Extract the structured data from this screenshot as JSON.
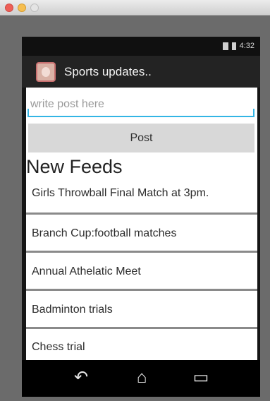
{
  "status_bar": {
    "time": "4:32"
  },
  "action_bar": {
    "title": "Sports updates.."
  },
  "post_form": {
    "placeholder": "write post here",
    "button_label": "Post"
  },
  "feeds": {
    "heading": "New Feeds",
    "items": [
      "Girls Throwball Final Match at 3pm.",
      "Branch Cup:football matches",
      "Annual Athelatic Meet",
      "Badminton trials",
      "Chess trial"
    ]
  },
  "nav": {
    "back_glyph": "↶",
    "home_glyph": "⌂",
    "recent_glyph": "▭"
  },
  "icons": {
    "app_icon": "app-avatar-icon",
    "signal_icon": "signal-icon",
    "battery_icon": "battery-icon"
  },
  "colors": {
    "accent": "#33b5e5",
    "action_bar": "#232323"
  }
}
